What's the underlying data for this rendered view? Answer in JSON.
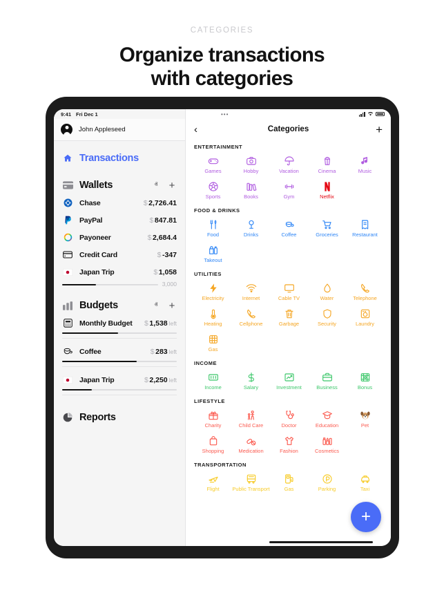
{
  "hero": {
    "eyebrow": "CATEGORIES",
    "title_line1": "Organize transactions",
    "title_line2": "with categories"
  },
  "colors": {
    "accent_blue": "#4a6cf7",
    "entertainment": "#b05ce0",
    "food": "#2f86f6",
    "utilities": "#f5a623",
    "income": "#3cc76a",
    "lifestyle": "#fb5a4f",
    "transportation": "#f7cb27",
    "netflix_red": "#e50914"
  },
  "sidebar": {
    "status_time": "9:41",
    "status_date": "Fri Dec 1",
    "account_name": "John Appleseed",
    "nav": {
      "transactions_label": "Transactions",
      "wallets_label": "Wallets",
      "budgets_label": "Budgets",
      "reports_label": "Reports",
      "collapse_glyph": "ⱏ",
      "add_glyph": "+"
    },
    "wallets": [
      {
        "name": "Chase",
        "currency": "$",
        "value": "2,726.41",
        "icon": "chase-icon"
      },
      {
        "name": "PayPal",
        "currency": "$",
        "value": "847.81",
        "icon": "paypal-icon"
      },
      {
        "name": "Payoneer",
        "currency": "$",
        "value": "2,684.4",
        "icon": "payoneer-icon"
      },
      {
        "name": "Credit Card",
        "currency": "$",
        "value": "-347",
        "icon": "credit-card-icon"
      },
      {
        "name": "Japan Trip",
        "currency": "$",
        "value": "1,058",
        "icon": "japan-flag-icon",
        "progress_pct": 35,
        "goal": "3,000"
      }
    ],
    "budgets": [
      {
        "name": "Monthly Budget",
        "currency": "$",
        "value": "1,538",
        "suffix": "left",
        "progress_pct": 49,
        "icon": "calculator-icon"
      },
      {
        "name": "Coffee",
        "currency": "$",
        "value": "283",
        "suffix": "left",
        "progress_pct": 65,
        "icon": "coffee-icon"
      },
      {
        "name": "Japan Trip",
        "currency": "$",
        "value": "2,250",
        "suffix": "left",
        "progress_pct": 26,
        "icon": "japan-flag-icon"
      }
    ]
  },
  "main": {
    "dots": "•••",
    "back_glyph": "‹",
    "title": "Categories",
    "add_glyph": "+",
    "fab_glyph": "+",
    "sections": [
      {
        "title": "ENTERTAINMENT",
        "color": "#b05ce0",
        "items": [
          {
            "label": "Games",
            "icon": "gamepad-icon"
          },
          {
            "label": "Hobby",
            "icon": "camera-icon"
          },
          {
            "label": "Vacation",
            "icon": "umbrella-icon"
          },
          {
            "label": "Cinema",
            "icon": "popcorn-icon"
          },
          {
            "label": "Music",
            "icon": "music-note-icon"
          },
          {
            "label": "Sports",
            "icon": "soccer-ball-icon"
          },
          {
            "label": "Books",
            "icon": "books-icon"
          },
          {
            "label": "Gym",
            "icon": "dumbbell-icon"
          },
          {
            "label": "Netflix",
            "icon": "netflix-icon",
            "color": "#e50914"
          }
        ]
      },
      {
        "title": "FOOD & DRINKS",
        "color": "#2f86f6",
        "items": [
          {
            "label": "Food",
            "icon": "fork-knife-icon"
          },
          {
            "label": "Drinks",
            "icon": "cocktail-glass-icon"
          },
          {
            "label": "Coffee",
            "icon": "coffee-cup-icon"
          },
          {
            "label": "Groceries",
            "icon": "shopping-cart-icon"
          },
          {
            "label": "Restaurant",
            "icon": "menu-card-icon"
          },
          {
            "label": "Takeout",
            "icon": "takeout-bag-icon"
          }
        ]
      },
      {
        "title": "UTILITIES",
        "color": "#f5a623",
        "items": [
          {
            "label": "Electricity",
            "icon": "lightning-bolt-icon"
          },
          {
            "label": "Internet",
            "icon": "wifi-icon"
          },
          {
            "label": "Cable TV",
            "icon": "monitor-icon"
          },
          {
            "label": "Water",
            "icon": "water-drop-icon"
          },
          {
            "label": "Telephone",
            "icon": "phone-handset-icon"
          },
          {
            "label": "Heating",
            "icon": "thermometer-icon"
          },
          {
            "label": "Cellphone",
            "icon": "mobile-phone-icon"
          },
          {
            "label": "Garbage",
            "icon": "trash-bin-icon"
          },
          {
            "label": "Security",
            "icon": "shield-icon"
          },
          {
            "label": "Laundry",
            "icon": "washing-machine-icon"
          },
          {
            "label": "Gas",
            "icon": "gas-burner-icon"
          }
        ]
      },
      {
        "title": "INCOME",
        "color": "#3cc76a",
        "items": [
          {
            "label": "Income",
            "icon": "banknote-icon"
          },
          {
            "label": "Salary",
            "icon": "dollar-sign-icon"
          },
          {
            "label": "Investment",
            "icon": "chart-up-icon"
          },
          {
            "label": "Business",
            "icon": "briefcase-icon"
          },
          {
            "label": "Bonus",
            "icon": "money-bag-icon"
          }
        ]
      },
      {
        "title": "LIFESTYLE",
        "color": "#fb5a4f",
        "items": [
          {
            "label": "Charity",
            "icon": "gift-box-icon"
          },
          {
            "label": "Child Care",
            "icon": "parent-child-icon"
          },
          {
            "label": "Doctor",
            "icon": "stethoscope-icon"
          },
          {
            "label": "Education",
            "icon": "graduation-cap-icon"
          },
          {
            "label": "Pet",
            "icon": "dog-face-icon"
          },
          {
            "label": "Shopping",
            "icon": "shopping-bag-icon"
          },
          {
            "label": "Medication",
            "icon": "pills-icon"
          },
          {
            "label": "Fashion",
            "icon": "tshirt-icon"
          },
          {
            "label": "Cosmetics",
            "icon": "cosmetics-icon"
          }
        ]
      },
      {
        "title": "TRANSPORTATION",
        "color": "#f7cb27",
        "items": [
          {
            "label": "Flight",
            "icon": "airplane-icon"
          },
          {
            "label": "Public Transport",
            "icon": "bus-icon"
          },
          {
            "label": "Gas",
            "icon": "fuel-pump-icon"
          },
          {
            "label": "Parking",
            "icon": "parking-sign-icon"
          },
          {
            "label": "Taxi",
            "icon": "taxi-icon"
          }
        ]
      }
    ]
  }
}
